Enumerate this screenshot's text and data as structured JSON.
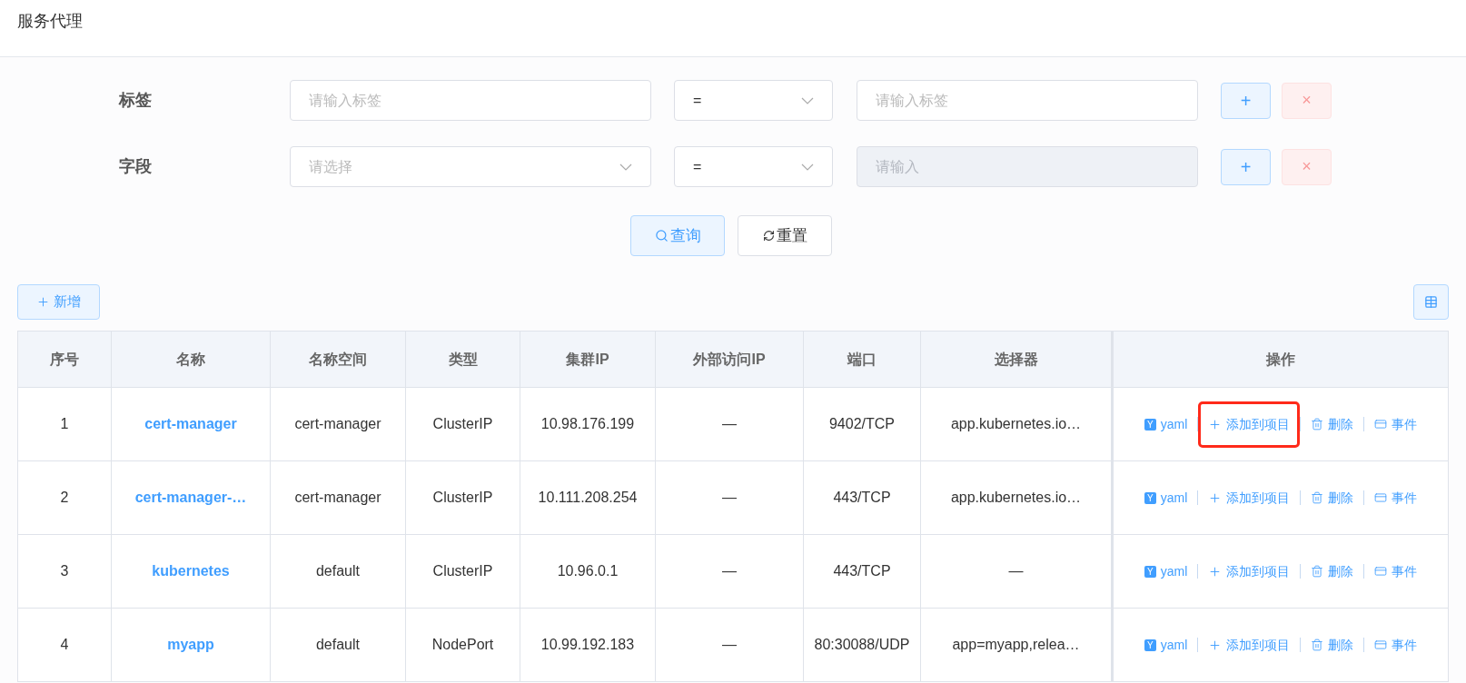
{
  "page_title": "服务代理",
  "filters": [
    {
      "label": "标签",
      "key_field": {
        "kind": "input",
        "placeholder": "请输入标签"
      },
      "operator": "=",
      "value_field": {
        "placeholder": "请输入标签",
        "disabled": false
      },
      "add": "+",
      "remove": "×"
    },
    {
      "label": "字段",
      "key_field": {
        "kind": "select",
        "placeholder": "请选择"
      },
      "operator": "=",
      "value_field": {
        "placeholder": "请输入",
        "disabled": true
      },
      "add": "+",
      "remove": "×"
    }
  ],
  "query_button": "查询",
  "reset_button": "重置",
  "new_button": "新增",
  "table": {
    "columns": [
      "序号",
      "名称",
      "名称空间",
      "类型",
      "集群IP",
      "外部访问IP",
      "端口",
      "选择器",
      "操作"
    ],
    "rows": [
      {
        "index": "1",
        "name": "cert-manager",
        "namespace": "cert-manager",
        "type": "ClusterIP",
        "cluster_ip": "10.98.176.199",
        "external_ip": "—",
        "port": "9402/TCP",
        "selector": "app.kubernetes.io…",
        "actions": [
          {
            "kind": "yaml",
            "label": "yaml",
            "icon_text": "Y",
            "highlighted": false
          },
          {
            "kind": "add",
            "label": "添加到项目",
            "highlighted": true
          },
          {
            "kind": "delete",
            "label": "删除",
            "highlighted": false
          },
          {
            "kind": "events",
            "label": "事件",
            "highlighted": false
          }
        ]
      },
      {
        "index": "2",
        "name": "cert-manager-…",
        "namespace": "cert-manager",
        "type": "ClusterIP",
        "cluster_ip": "10.111.208.254",
        "external_ip": "—",
        "port": "443/TCP",
        "selector": "app.kubernetes.io…",
        "actions": [
          {
            "kind": "yaml",
            "label": "yaml",
            "icon_text": "Y",
            "highlighted": false
          },
          {
            "kind": "add",
            "label": "添加到项目",
            "highlighted": false
          },
          {
            "kind": "delete",
            "label": "删除",
            "highlighted": false
          },
          {
            "kind": "events",
            "label": "事件",
            "highlighted": false
          }
        ]
      },
      {
        "index": "3",
        "name": "kubernetes",
        "namespace": "default",
        "type": "ClusterIP",
        "cluster_ip": "10.96.0.1",
        "external_ip": "—",
        "port": "443/TCP",
        "selector": "—",
        "actions": [
          {
            "kind": "yaml",
            "label": "yaml",
            "icon_text": "Y",
            "highlighted": false
          },
          {
            "kind": "add",
            "label": "添加到项目",
            "highlighted": false
          },
          {
            "kind": "delete",
            "label": "删除",
            "highlighted": false
          },
          {
            "kind": "events",
            "label": "事件",
            "highlighted": false
          }
        ]
      },
      {
        "index": "4",
        "name": "myapp",
        "namespace": "default",
        "type": "NodePort",
        "cluster_ip": "10.99.192.183",
        "external_ip": "—",
        "port": "80:30088/UDP",
        "selector": "app=myapp,relea…",
        "actions": [
          {
            "kind": "yaml",
            "label": "yaml",
            "icon_text": "Y",
            "highlighted": false
          },
          {
            "kind": "add",
            "label": "添加到项目",
            "highlighted": false
          },
          {
            "kind": "delete",
            "label": "删除",
            "highlighted": false
          },
          {
            "kind": "events",
            "label": "事件",
            "highlighted": false
          }
        ]
      }
    ]
  }
}
